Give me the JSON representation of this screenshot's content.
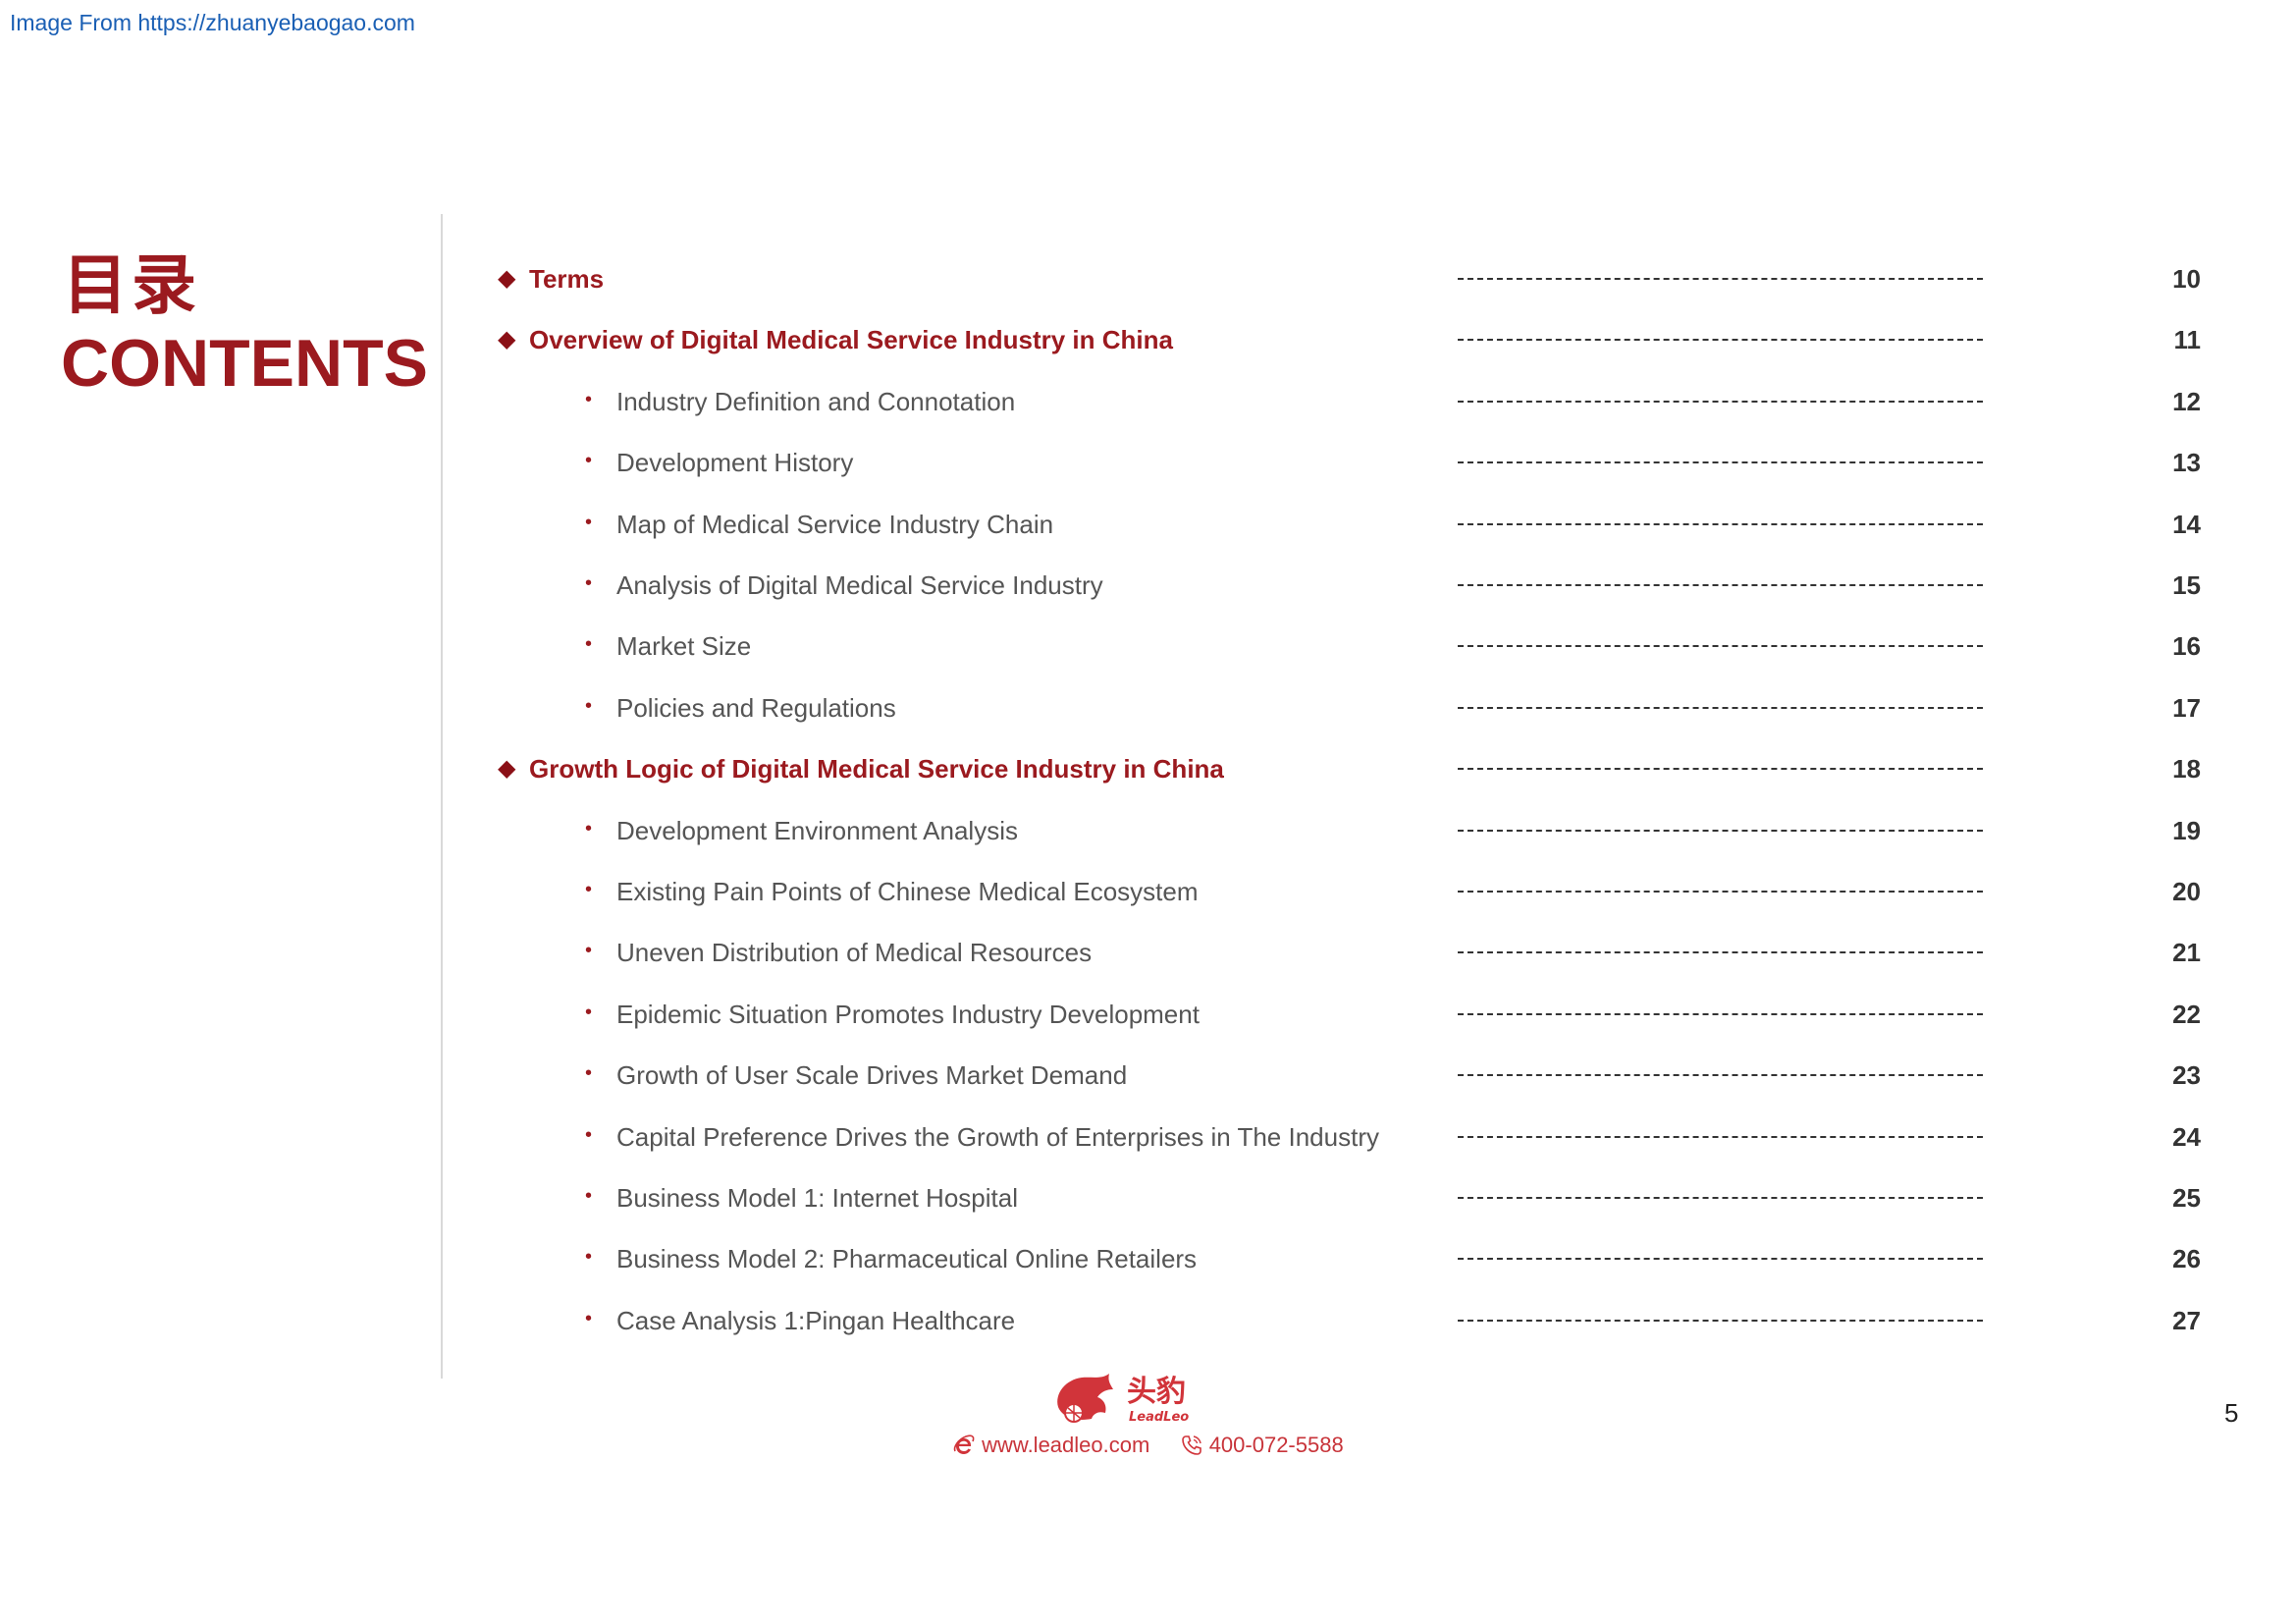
{
  "source_link": "Image From https://zhuanyebaogao.com",
  "title": {
    "zh": "目录",
    "en": "CONTENTS"
  },
  "toc": [
    {
      "level": 1,
      "text": "Terms",
      "page": "10"
    },
    {
      "level": 1,
      "text": "Overview of Digital Medical Service Industry in China",
      "page": "11"
    },
    {
      "level": 2,
      "text": "Industry Definition and Connotation",
      "page": "12"
    },
    {
      "level": 2,
      "text": "Development History",
      "page": "13"
    },
    {
      "level": 2,
      "text": "Map of Medical Service Industry Chain",
      "page": "14"
    },
    {
      "level": 2,
      "text": "Analysis of Digital Medical Service Industry",
      "page": "15"
    },
    {
      "level": 2,
      "text": "Market Size",
      "page": "16"
    },
    {
      "level": 2,
      "text": "Policies and Regulations",
      "page": "17"
    },
    {
      "level": 1,
      "text": "Growth Logic of Digital Medical Service Industry in China",
      "page": "18"
    },
    {
      "level": 2,
      "text": "Development Environment Analysis",
      "page": "19"
    },
    {
      "level": 2,
      "text": "Existing Pain Points of Chinese Medical Ecosystem",
      "page": "20"
    },
    {
      "level": 2,
      "text": "Uneven Distribution of Medical Resources",
      "page": "21"
    },
    {
      "level": 2,
      "text": "Epidemic Situation Promotes Industry Development",
      "page": "22"
    },
    {
      "level": 2,
      "text": "Growth of User Scale Drives Market Demand",
      "page": "23"
    },
    {
      "level": 2,
      "text": "Capital Preference Drives the Growth of Enterprises in The Industry",
      "page": "24"
    },
    {
      "level": 2,
      "text": "Business Model 1: Internet Hospital",
      "page": "25"
    },
    {
      "level": 2,
      "text": "Business Model 2: Pharmaceutical Online Retailers",
      "page": "26"
    },
    {
      "level": 2,
      "text": "Case Analysis 1:Pingan Healthcare",
      "page": "27"
    }
  ],
  "footer": {
    "logo_zh": "头豹",
    "logo_en": "LeadLeo",
    "website": "www.leadleo.com",
    "phone": "400-072-5588",
    "web_icon": "ie-e-icon",
    "phone_icon": "phone-icon",
    "brand_color": "#d1343a"
  },
  "slide_number": "5",
  "colors": {
    "accent": "#9b1a1f",
    "body_text": "#555555",
    "link": "#1a5fb4"
  }
}
